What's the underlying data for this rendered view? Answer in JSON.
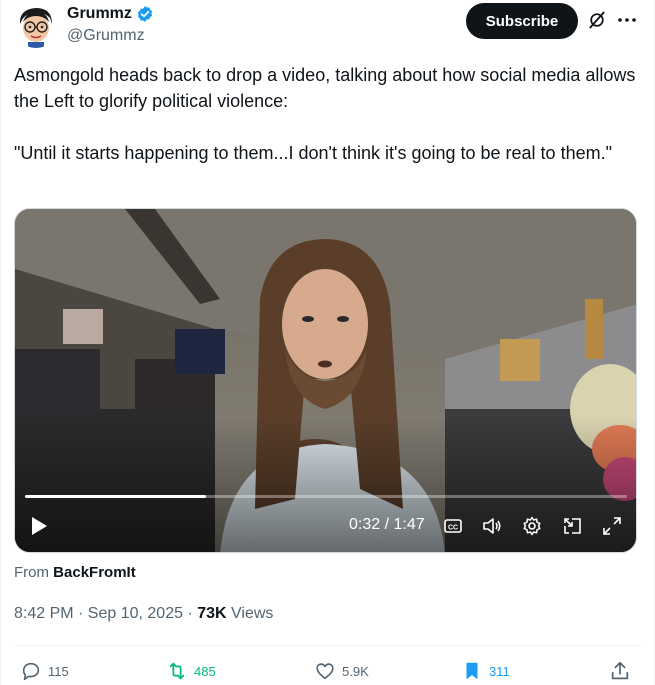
{
  "author": {
    "display_name": "Grummz",
    "handle": "@Grummz",
    "verified_icon": "verified-badge-icon",
    "avatar_icon": "cartoon-avatar"
  },
  "header": {
    "subscribe_label": "Subscribe",
    "grok_icon": "grok-icon",
    "more_icon": "more-dots-icon"
  },
  "tweet": {
    "paragraph_1": "Asmongold heads back to drop a video, talking about how social media allows the Left to glorify political violence:",
    "paragraph_2": "\"Until it starts happening to them...I don't think it's going to be real to them.\""
  },
  "video": {
    "time_display": "0:32 / 1:47",
    "progress_fraction": 0.3,
    "controls": [
      "play-icon",
      "captions-icon",
      "volume-icon",
      "settings-icon",
      "pip-icon",
      "fullscreen-icon"
    ]
  },
  "source": {
    "prefix": "From ",
    "name": "BackFromIt"
  },
  "meta": {
    "time_date": "8:42 PM · Sep 10, 2025 · ",
    "views_count": "73K",
    "views_label": " Views"
  },
  "actions": {
    "replies": "115",
    "retweets": "485",
    "likes": "5.9K",
    "bookmarks": "311"
  },
  "colors": {
    "text": "#0f1419",
    "secondary": "#536471",
    "verified": "#1d9bf0",
    "retweet": "#00ba7c",
    "bookmark": "#1d9bf0"
  }
}
